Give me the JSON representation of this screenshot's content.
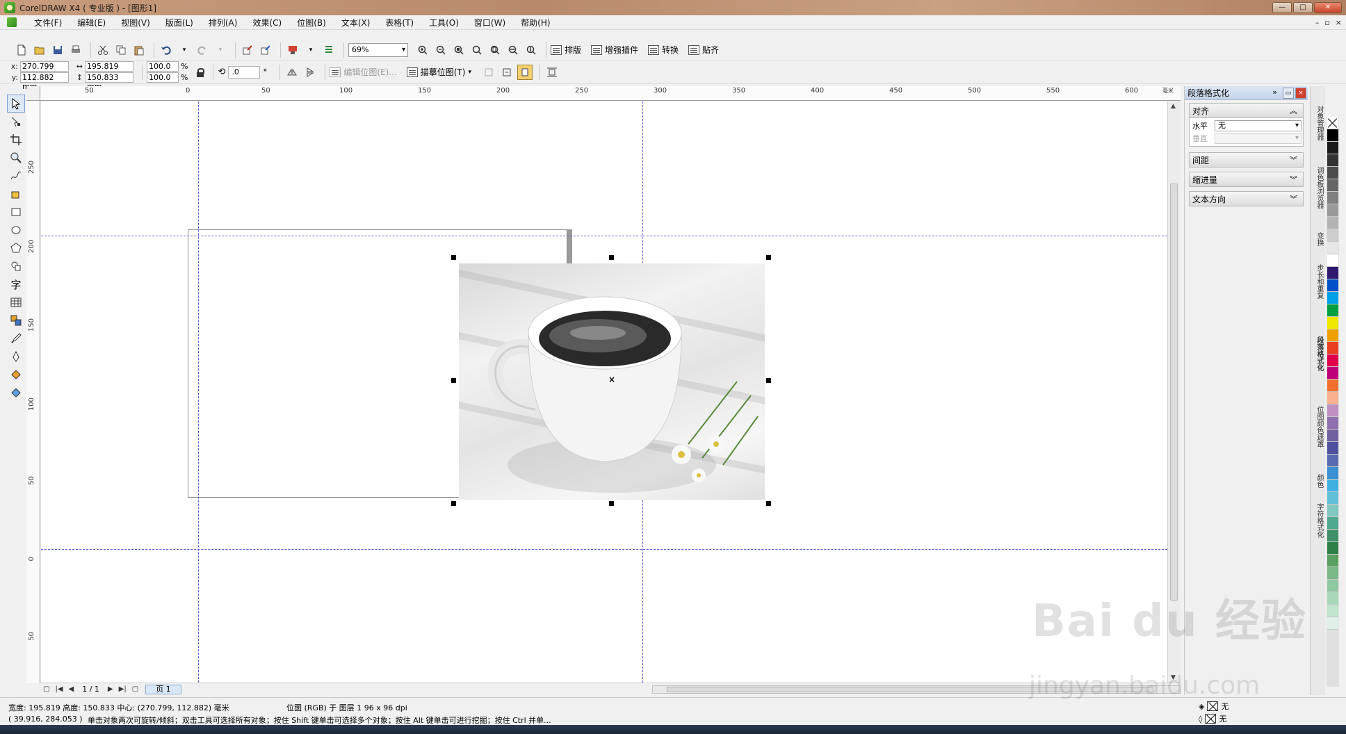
{
  "window": {
    "title": "CorelDRAW X4 ( 专业版 ) - [图形1]",
    "minimize": "—",
    "maximize": "□",
    "close": "✕"
  },
  "menu": {
    "items": [
      "文件(F)",
      "编辑(E)",
      "视图(V)",
      "版面(L)",
      "排列(A)",
      "效果(C)",
      "位图(B)",
      "文本(X)",
      "表格(T)",
      "工具(O)",
      "窗口(W)",
      "帮助(H)"
    ],
    "doc_controls": [
      "–",
      "▫",
      "×"
    ]
  },
  "toolbar": {
    "zoom": "69%",
    "buttons": [
      "排版",
      "增强插件",
      "转换",
      "贴齐"
    ]
  },
  "property_bar": {
    "x_label": "x:",
    "x_value": "270.799 mm",
    "y_label": "y:",
    "y_value": "112.882 mm",
    "width_value": "195.819 mm",
    "height_value": "150.833 mm",
    "scale_w": "100.0",
    "scale_h": "100.0",
    "pct": "%",
    "angle": ".0",
    "degree": "°",
    "edit_bitmap": "编辑位图(E)...",
    "trace_bitmap": "描摹位图(T)"
  },
  "ruler": {
    "h_ticks": [
      "50",
      "0",
      "50",
      "100",
      "150",
      "200",
      "250",
      "300",
      "350",
      "400",
      "450",
      "500",
      "550",
      "600",
      "毫米"
    ],
    "v_ticks": [
      "250",
      "200",
      "150",
      "100",
      "50",
      "0",
      "50"
    ]
  },
  "page_nav": {
    "count": "1 / 1",
    "tab": "页 1"
  },
  "docker": {
    "title": "段落格式化",
    "sections": [
      {
        "name": "对齐",
        "expanded": true
      },
      {
        "name": "间距",
        "expanded": false
      },
      {
        "name": "缩进量",
        "expanded": false
      },
      {
        "name": "文本方向",
        "expanded": false
      }
    ],
    "align": {
      "horizontal_label": "水平",
      "horizontal_value": "无",
      "vertical_label": "垂直",
      "vertical_value": ""
    },
    "vertical_tabs": [
      "对象管理器",
      "调色板浏览器",
      "变换",
      "步长和重复",
      "段落格式化",
      "位图颜色遮罩",
      "颜色",
      "字符格式化"
    ]
  },
  "palette": {
    "colors": [
      "#000000",
      "#1a1a1a",
      "#333333",
      "#4d4d4d",
      "#666666",
      "#808080",
      "#999999",
      "#b3b3b3",
      "#cccccc",
      "#e6e6e6",
      "#ffffff",
      "#2e1a6e",
      "#0050c8",
      "#00a0e8",
      "#00a040",
      "#f0e800",
      "#f0a000",
      "#e84020",
      "#e0004a",
      "#c00078",
      "#f07030",
      "#f8b090",
      "#c090c0",
      "#9070b0",
      "#7060a0",
      "#5050a0",
      "#5a6ab0",
      "#3a90d0",
      "#40b0e0",
      "#60c0d8",
      "#80c8c0",
      "#50a890",
      "#40906a",
      "#2f8048",
      "#5aa060",
      "#7ab888",
      "#8fc8a0",
      "#a8d8b8",
      "#c0e4cc",
      "#e0f0e8"
    ]
  },
  "status": {
    "line1": "宽度: 195.819  高度: 150.833  中心: (270.799, 112.882)  毫米",
    "line1_right": "位图 (RGB) 于 图层 1  96 x 96 dpi",
    "line2_coords": "( 39.916, 284.053 )",
    "line2_hint": "单击对象两次可旋转/倾斜；双击工具可选择所有对象；按住 Shift 键单击可选择多个对象；按住 Alt 键单击可进行挖掘；按住 Ctrl 并单...",
    "fill": "无",
    "outline": "无"
  },
  "watermark": {
    "main": "Bai du 经验",
    "sub": "jingyan.baidu.com"
  }
}
